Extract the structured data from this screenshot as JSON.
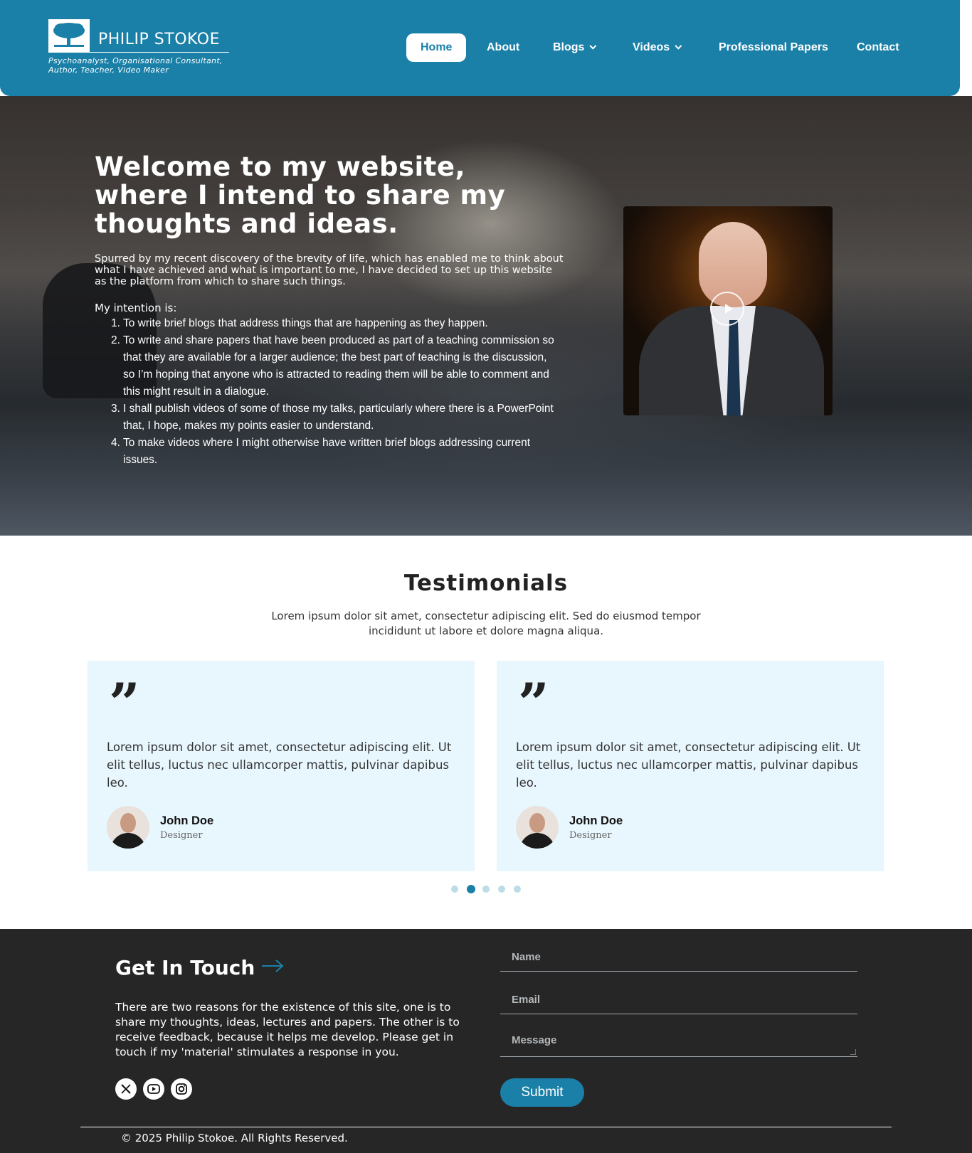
{
  "brand": {
    "name": "PHILIP STOKOE",
    "tagline": "Psychoanalyst, Organisational Consultant, Author, Teacher, Video Maker",
    "logo_icon": "tree-icon",
    "color": "#1a80a8"
  },
  "nav": {
    "items": [
      {
        "label": "Home",
        "active": true
      },
      {
        "label": "About"
      },
      {
        "label": "Blogs",
        "dropdown": true
      },
      {
        "label": "Videos",
        "dropdown": true
      },
      {
        "label": "Professional Papers"
      },
      {
        "label": "Contact"
      }
    ]
  },
  "hero": {
    "title": "Welcome to my website, where I intend to share my thoughts and ideas.",
    "intro": "Spurred by my recent discovery of the brevity of life, which has enabled me to think about what I have achieved and what is important to me, I have decided to set up this website as the platform from which to share such things.",
    "intention_label": "My intention is:",
    "list": [
      "To write brief blogs that address things that are happening as they happen.",
      "To write and share papers that have been produced as part of a teaching commission so that they are available for a larger audience; the best part of teaching is the discussion, so I’m hoping that anyone who is attracted to reading them will be able to comment and this might result in a dialogue.",
      "I shall publish videos of some of those my talks, particularly where there is a PowerPoint that, I hope, makes my points easier to understand.",
      "To make videos where I might otherwise have written brief blogs addressing current issues."
    ],
    "video_icon": "play-icon"
  },
  "testimonials": {
    "title": "Testimonials",
    "subtitle": "Lorem ipsum dolor sit amet, consectetur adipiscing elit. Sed do eiusmod tempor incididunt ut labore et dolore magna aliqua.",
    "quote_mark": "”",
    "cards": [
      {
        "text": "Lorem ipsum dolor sit amet, consectetur adipiscing elit. Ut elit tellus, luctus nec ullamcorper mattis, pulvinar dapibus leo.",
        "name": "John Doe",
        "role": "Designer"
      },
      {
        "text": "Lorem ipsum dolor sit amet, consectetur adipiscing elit. Ut elit tellus, luctus nec ullamcorper mattis, pulvinar dapibus leo.",
        "name": "John Doe",
        "role": "Designer"
      }
    ],
    "pagination": {
      "count": 5,
      "active_index": 1
    }
  },
  "contact": {
    "title": "Get In Touch",
    "text": "There are two reasons for the existence of this site, one is to share my thoughts, ideas, lectures and papers. The other is to receive feedback, because it helps me develop. Please get in touch if my 'material' stimulates a response in you.",
    "form": {
      "name_placeholder": "Name",
      "email_placeholder": "Email",
      "message_placeholder": "Message",
      "submit_label": "Submit"
    },
    "social": [
      "x-icon",
      "youtube-icon",
      "instagram-icon"
    ]
  },
  "footer": {
    "copyright": "© 2025 Philip Stokoe. All Rights Reserved."
  }
}
